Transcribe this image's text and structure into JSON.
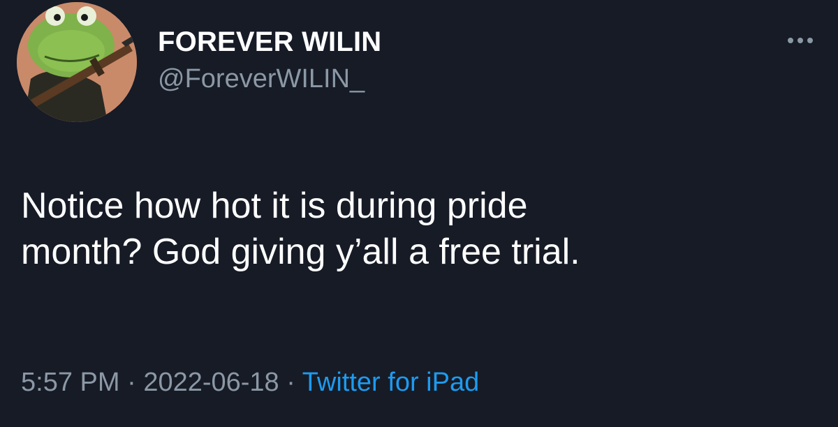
{
  "user": {
    "display_name": "FOREVER WILIN",
    "handle": "@ForeverWILIN_"
  },
  "tweet": {
    "text_line_1": "Notice how hot it is during pride",
    "text_line_2": "month? God giving y’all a free trial.",
    "time": "5:57 PM",
    "separator": " · ",
    "date": "2022-06-18",
    "source": "Twitter for iPad"
  },
  "icons": {
    "more": "more-horizontal-icon",
    "avatar": "frog-avatar-image"
  },
  "colors": {
    "background": "#161b26",
    "primary_text": "#ffffff",
    "secondary_text": "#8b98a5",
    "link": "#1d9bf0"
  }
}
